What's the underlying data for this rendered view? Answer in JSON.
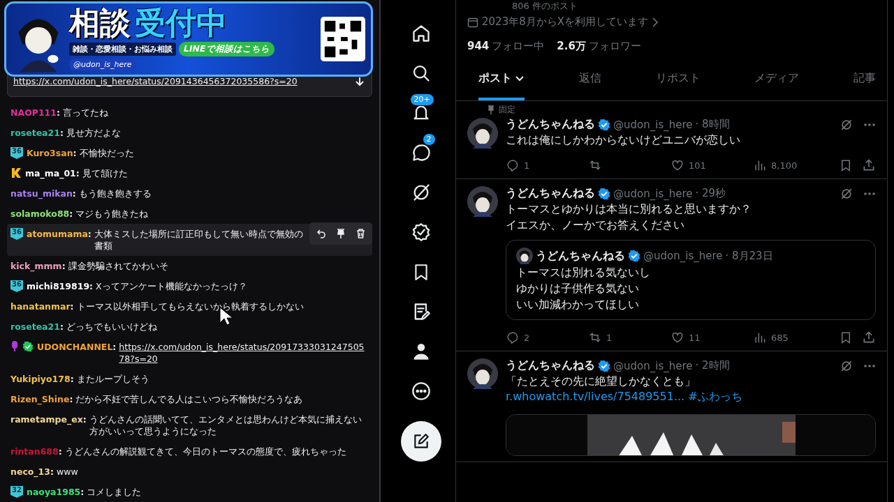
{
  "banner": {
    "title_a": "相談",
    "title_b": "受付中",
    "topics": "雑談・恋愛相談・お悩み相談",
    "line_button": "LINEで相談はこちら",
    "handle": "@udon_is_here"
  },
  "chat": {
    "pinned_link": "https://x.com/udon_is_here/status/2091436456372035586?s=20",
    "messages": [
      {
        "user": "NAOP111",
        "sep": ":",
        "color": "#e0309a",
        "text": "言ってたね",
        "kind": "text",
        "hovered": false
      },
      {
        "user": "rosetea21",
        "sep": ":",
        "color": "#2fc4a6",
        "text": "見せ方だよな",
        "kind": "text",
        "hovered": false
      },
      {
        "user": "Kuro3san",
        "sep": ":",
        "color": "#f0a23a",
        "badges": [
          {
            "kind": "sub",
            "label": "36"
          }
        ],
        "text": "不愉快だった",
        "kind": "text",
        "hovered": false
      },
      {
        "user": "ma_ma_01",
        "sep": ":",
        "color": "#ffffff",
        "badges": [
          {
            "kind": "k"
          }
        ],
        "text": "見て頷けた",
        "kind": "text",
        "hovered": false
      },
      {
        "user": "natsu_mikan",
        "sep": ":",
        "color": "#a97ff0",
        "text": "もう飽き飽きする",
        "kind": "text",
        "hovered": false
      },
      {
        "user": "solamoko88",
        "sep": ":",
        "color": "#8ee07a",
        "text": "マジもう飽きたね",
        "kind": "text",
        "hovered": false
      },
      {
        "user": "atomumama",
        "sep": ":",
        "color": "#f2b84b",
        "badges": [
          {
            "kind": "sub",
            "label": "36"
          }
        ],
        "text": "大体ミスした場所に訂正印もして無い時点で無効の書類",
        "kind": "text",
        "hovered": true
      },
      {
        "user": "kick_mmm",
        "sep": ":",
        "color": "#e8a0b8",
        "text": "課金勢騙されてかわいそ",
        "kind": "text",
        "hovered": false
      },
      {
        "user": "michi819819",
        "sep": ":",
        "color": "#ffffff",
        "badges": [
          {
            "kind": "sub",
            "label": "36"
          }
        ],
        "text": "Xってアンケート機能なかったっけ？",
        "kind": "text",
        "hovered": false
      },
      {
        "user": "hanatanmar",
        "sep": ":",
        "color": "#f2c14e",
        "text": "トーマス以外相手してもらえないから執着するしかない",
        "kind": "text",
        "hovered": false
      },
      {
        "user": "rosetea21",
        "sep": ":",
        "color": "#2fc4a6",
        "text": "どっちでもいいけどね",
        "kind": "text",
        "hovered": false
      },
      {
        "user": "UDONCHANNEL",
        "sep": ":",
        "color": "#f0a23a",
        "badges": [
          {
            "kind": "mic"
          },
          {
            "kind": "verified"
          }
        ],
        "text": "https://x.com/udon_is_here/status/2091733303124750578?s=20",
        "kind": "link",
        "hovered": false
      },
      {
        "user": "Yukipiyo178",
        "sep": ":",
        "color": "#f2c14e",
        "text": "またループしそう",
        "kind": "text",
        "hovered": false
      },
      {
        "user": "Rizen_Shine",
        "sep": ":",
        "color": "#f0a23a",
        "text": "だから不妊で苦しんでる人はこいつら不愉快だろうなあ",
        "kind": "text",
        "hovered": false
      },
      {
        "user": "rametampe_ex",
        "sep": ":",
        "color": "#f2d49a",
        "text": "うどんさんの話聞いてて、エンタメとは思わんけど本気に捕えない方がいいって思うようになった",
        "kind": "text",
        "hovered": false
      },
      {
        "user": "rintan688",
        "sep": ":",
        "color": "#c8163a",
        "text": "うどんさんの解説観てきて、今日のトーマスの態度で、疲れちゃった",
        "kind": "text",
        "hovered": false
      },
      {
        "user": "neco_13",
        "sep": ":",
        "color": "#f2d49a",
        "text": "www",
        "kind": "text",
        "hovered": false
      },
      {
        "user": "naoya1985",
        "sep": ":",
        "color": "#3ee07a",
        "badges": [
          {
            "kind": "sub",
            "label": "32"
          }
        ],
        "text": "コメしました",
        "kind": "text",
        "hovered": false
      }
    ]
  },
  "sidebar": {
    "items": [
      {
        "kind": "home"
      },
      {
        "kind": "search"
      },
      {
        "kind": "bell",
        "badge": "20+"
      },
      {
        "kind": "chat",
        "badge": "2"
      },
      {
        "kind": "grok"
      },
      {
        "kind": "verified"
      },
      {
        "kind": "bookmark"
      },
      {
        "kind": "article"
      },
      {
        "kind": "profile"
      },
      {
        "kind": "more"
      },
      {
        "kind": "compose"
      }
    ]
  },
  "profile": {
    "post_count": "806 件のポスト",
    "joined": "2023年8月からXを利用しています",
    "following_count": "944",
    "following_label": "フォロー中",
    "followers_count": "2.6万",
    "followers_label": "フォロワー"
  },
  "tabs": [
    {
      "label": "ポスト",
      "selected": true
    },
    {
      "label": "返信",
      "selected": false
    },
    {
      "label": "リポスト",
      "selected": false
    },
    {
      "label": "メディア",
      "selected": false
    },
    {
      "label": "記事",
      "selected": false
    }
  ],
  "posts": [
    {
      "pinned_label": "固定",
      "name": "うどんちゃんねる",
      "handle": "@udon_is_here",
      "time": "· 8時間",
      "lines": [
        "これは俺にしかわからないけどユニバが恋しい"
      ],
      "stats": [
        {
          "kind": "reply",
          "count": "1"
        },
        {
          "kind": "repost"
        },
        {
          "kind": "like",
          "count": "101"
        },
        {
          "kind": "views",
          "count": "8,100"
        }
      ]
    },
    {
      "name": "うどんちゃんねる",
      "handle": "@udon_is_here",
      "time": "· 29秒",
      "lines": [
        "トーマスとゆかりは本当に別れると思いますか？",
        "イエスか、ノーかでお答えください"
      ],
      "quote": {
        "name": "うどんちゃんねる",
        "handle": "@udon_is_here",
        "time": "· 8月23日",
        "lines": [
          "トーマスは別れる気ないし",
          "ゆかりは子供作る気ない",
          "いい加減わかってほしい"
        ]
      },
      "stats": [
        {
          "kind": "reply",
          "count": "2"
        },
        {
          "kind": "repost",
          "count": "1"
        },
        {
          "kind": "like",
          "count": "11"
        },
        {
          "kind": "views",
          "count": "685"
        }
      ]
    },
    {
      "name": "うどんちゃんねる",
      "handle": "@udon_is_here",
      "time": "· 2時間",
      "lines": [
        "「たとえその先に絶望しかなくとも」"
      ],
      "link": "r.whowatch.tv/lives/75489551...",
      "hashtag": "#ふわっち",
      "media": {
        "kind": "picture"
      }
    }
  ]
}
